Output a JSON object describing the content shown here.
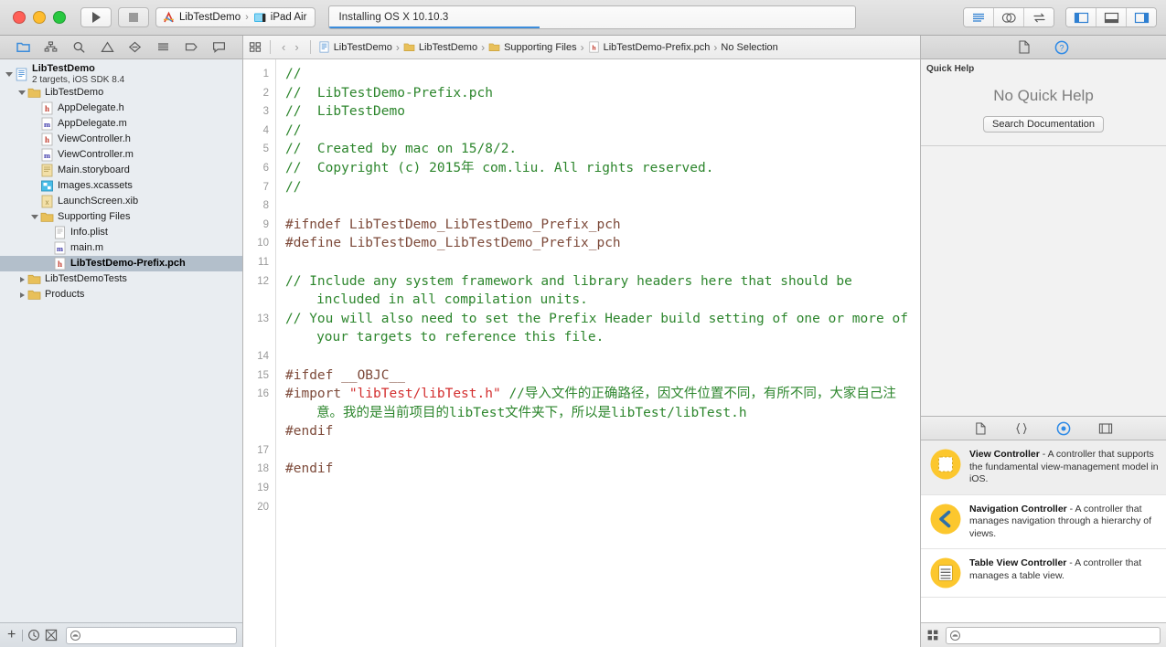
{
  "window": {
    "traffic_lights": [
      "close",
      "minimize",
      "maximize"
    ],
    "scheme_project": "LibTestDemo",
    "scheme_separator": "›",
    "scheme_destination": "iPad Air",
    "status_text": "Installing OS X 10.10.3",
    "progress_percent": 40
  },
  "toolbar": {
    "run_label": "Run",
    "stop_label": "Stop",
    "editor_modes": [
      "standard-editor",
      "assistant-editor",
      "version-editor"
    ],
    "view_toggles": [
      "navigator-toggle",
      "debug-area-toggle",
      "utilities-toggle"
    ]
  },
  "navigator": {
    "tabs": [
      {
        "name": "project-navigator",
        "icon": "folder-icon",
        "active": true
      },
      {
        "name": "symbol-navigator",
        "icon": "hierarchy-icon",
        "active": false
      },
      {
        "name": "find-navigator",
        "icon": "search-icon",
        "active": false
      },
      {
        "name": "issue-navigator",
        "icon": "warning-icon",
        "active": false
      },
      {
        "name": "test-navigator",
        "icon": "diamond-icon",
        "active": false
      },
      {
        "name": "debug-navigator",
        "icon": "debug-icon",
        "active": false
      },
      {
        "name": "breakpoint-navigator",
        "icon": "tag-icon",
        "active": false
      },
      {
        "name": "report-navigator",
        "icon": "speech-icon",
        "active": false
      }
    ],
    "project": {
      "title": "LibTestDemo",
      "subtitle": "2 targets, iOS SDK 8.4"
    },
    "tree": [
      {
        "label": "LibTestDemo",
        "icon": "folder-icon",
        "indent": 1,
        "twisty": "open",
        "selected": false
      },
      {
        "label": "AppDelegate.h",
        "icon": "header-file-icon",
        "indent": 2,
        "twisty": "none",
        "selected": false
      },
      {
        "label": "AppDelegate.m",
        "icon": "source-file-icon",
        "indent": 2,
        "twisty": "none",
        "selected": false
      },
      {
        "label": "ViewController.h",
        "icon": "header-file-icon",
        "indent": 2,
        "twisty": "none",
        "selected": false
      },
      {
        "label": "ViewController.m",
        "icon": "source-file-icon",
        "indent": 2,
        "twisty": "none",
        "selected": false
      },
      {
        "label": "Main.storyboard",
        "icon": "storyboard-icon",
        "indent": 2,
        "twisty": "none",
        "selected": false
      },
      {
        "label": "Images.xcassets",
        "icon": "assets-icon",
        "indent": 2,
        "twisty": "none",
        "selected": false
      },
      {
        "label": "LaunchScreen.xib",
        "icon": "xib-icon",
        "indent": 2,
        "twisty": "none",
        "selected": false
      },
      {
        "label": "Supporting Files",
        "icon": "folder-icon",
        "indent": 2,
        "twisty": "open",
        "selected": false
      },
      {
        "label": "Info.plist",
        "icon": "plist-icon",
        "indent": 3,
        "twisty": "none",
        "selected": false
      },
      {
        "label": "main.m",
        "icon": "source-file-icon",
        "indent": 3,
        "twisty": "none",
        "selected": false
      },
      {
        "label": "LibTestDemo-Prefix.pch",
        "icon": "header-file-icon",
        "indent": 3,
        "twisty": "none",
        "selected": true
      },
      {
        "label": "LibTestDemoTests",
        "icon": "folder-icon",
        "indent": 1,
        "twisty": "closed",
        "selected": false
      },
      {
        "label": "Products",
        "icon": "folder-icon",
        "indent": 1,
        "twisty": "closed",
        "selected": false
      }
    ],
    "bottom": {
      "add_label": "+",
      "recent_icon": "clock-icon",
      "source-control_icon": "source-control-icon",
      "filter_placeholder": ""
    }
  },
  "editor": {
    "breadcrumb": [
      {
        "label": "LibTestDemo",
        "icon": "project-icon"
      },
      {
        "label": "LibTestDemo",
        "icon": "folder-icon"
      },
      {
        "label": "Supporting Files",
        "icon": "folder-icon"
      },
      {
        "label": "LibTestDemo-Prefix.pch",
        "icon": "header-file-icon"
      },
      {
        "label": "No Selection",
        "icon": "none"
      }
    ],
    "separator": "›",
    "back_label": "‹",
    "forward_label": "›",
    "line_numbers": [
      "1",
      "2",
      "3",
      "4",
      "5",
      "6",
      "7",
      "8",
      "9",
      "10",
      "11",
      "12",
      "",
      "13",
      "",
      "14",
      "15",
      "16",
      "",
      "",
      "17",
      "18",
      "19",
      "20"
    ],
    "code": [
      {
        "n": "1",
        "segments": [
          {
            "t": "//",
            "c": "comment"
          }
        ]
      },
      {
        "n": "2",
        "segments": [
          {
            "t": "//  LibTestDemo-Prefix.pch",
            "c": "comment"
          }
        ]
      },
      {
        "n": "3",
        "segments": [
          {
            "t": "//  LibTestDemo",
            "c": "comment"
          }
        ]
      },
      {
        "n": "4",
        "segments": [
          {
            "t": "//",
            "c": "comment"
          }
        ]
      },
      {
        "n": "5",
        "segments": [
          {
            "t": "//  Created by mac on 15/8/2.",
            "c": "comment"
          }
        ]
      },
      {
        "n": "6",
        "segments": [
          {
            "t": "//  Copyright (c) 2015年 com.liu. All rights reserved.",
            "c": "comment"
          }
        ]
      },
      {
        "n": "7",
        "segments": [
          {
            "t": "//",
            "c": "comment"
          }
        ]
      },
      {
        "n": "8",
        "segments": [
          {
            "t": "",
            "c": "plain"
          }
        ]
      },
      {
        "n": "9",
        "segments": [
          {
            "t": "#ifndef LibTestDemo_LibTestDemo_Prefix_pch",
            "c": "preprocessor"
          }
        ]
      },
      {
        "n": "10",
        "segments": [
          {
            "t": "#define LibTestDemo_LibTestDemo_Prefix_pch",
            "c": "preprocessor"
          }
        ]
      },
      {
        "n": "11",
        "segments": [
          {
            "t": "",
            "c": "plain"
          }
        ]
      },
      {
        "n": "12",
        "segments": [
          {
            "t": "// Include any system framework and library headers here that should be included in all compilation units.",
            "c": "comment"
          }
        ],
        "wrapped": true
      },
      {
        "n": "13",
        "segments": [
          {
            "t": "// You will also need to set the Prefix Header build setting of one or more of your targets to reference this file.",
            "c": "comment"
          }
        ],
        "wrapped": true
      },
      {
        "n": "14",
        "segments": [
          {
            "t": "",
            "c": "plain"
          }
        ]
      },
      {
        "n": "15",
        "segments": [
          {
            "t": "#ifdef __OBJC__",
            "c": "preprocessor"
          }
        ]
      },
      {
        "n": "16",
        "segments": [
          {
            "t": "#import ",
            "c": "preprocessor"
          },
          {
            "t": "\"libTest/libTest.h\"",
            "c": "string"
          },
          {
            "t": " //导入文件的正确路径，因文件位置不同，有所不同，大家自己注意。我的是当前项目的libTest文件夹下，所以是libTest/libTest.h",
            "c": "comment"
          }
        ],
        "wrapped": true
      },
      {
        "n": "17",
        "segments": [
          {
            "t": "#endif",
            "c": "preprocessor"
          }
        ]
      },
      {
        "n": "18",
        "segments": [
          {
            "t": "",
            "c": "plain"
          }
        ]
      },
      {
        "n": "19",
        "segments": [
          {
            "t": "#endif",
            "c": "preprocessor"
          }
        ]
      },
      {
        "n": "20",
        "segments": [
          {
            "t": "",
            "c": "plain"
          }
        ]
      }
    ]
  },
  "utilities": {
    "tabs": [
      {
        "name": "file-inspector",
        "icon": "file-icon",
        "active": false
      },
      {
        "name": "quick-help-inspector",
        "icon": "help-icon",
        "active": true
      }
    ],
    "quick_help": {
      "title": "Quick Help",
      "message": "No Quick Help",
      "button": "Search Documentation"
    },
    "library_tabs": [
      {
        "name": "file-template-library",
        "icon": "file-icon",
        "active": false
      },
      {
        "name": "code-snippet-library",
        "icon": "braces-icon",
        "active": false
      },
      {
        "name": "object-library",
        "icon": "object-icon",
        "active": true
      },
      {
        "name": "media-library",
        "icon": "media-icon",
        "active": false
      }
    ],
    "library_items": [
      {
        "name": "View Controller",
        "dash": " - ",
        "desc": "A controller that supports the fundamental view-management model in iOS.",
        "icon": "view-controller-icon",
        "selected": true
      },
      {
        "name": "Navigation Controller",
        "dash": " - ",
        "desc": "A controller that manages navigation through a hierarchy of views.",
        "icon": "navigation-controller-icon",
        "selected": false
      },
      {
        "name": "Table View Controller",
        "dash": " - ",
        "desc": "A controller that manages a table view.",
        "icon": "table-view-controller-icon",
        "selected": false
      }
    ],
    "bottom": {
      "grid_icon": "grid-icon",
      "filter_placeholder": ""
    }
  },
  "colors": {
    "accent": "#3b8cdb",
    "comment": "#2d862d",
    "preprocessor": "#7d4a3a",
    "string": "#d32f2f",
    "selection": "#b3bfcb",
    "library_icon": "#fcc72e"
  }
}
